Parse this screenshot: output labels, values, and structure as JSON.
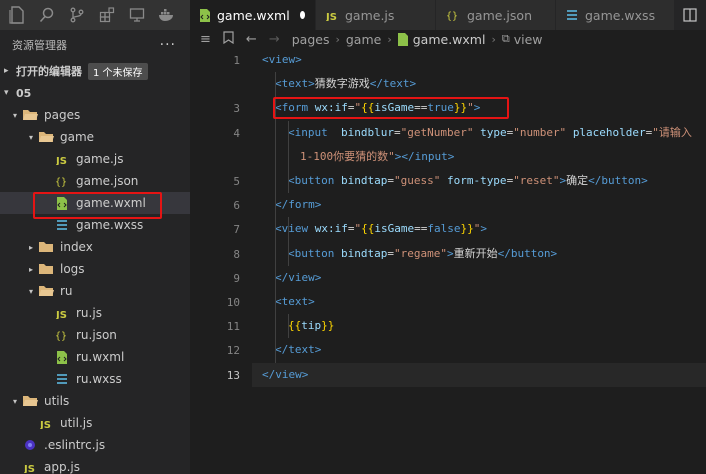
{
  "activity_icons": [
    "files-icon",
    "search-icon",
    "source-control-icon",
    "extensions-icon",
    "debug-icon",
    "docker-icon"
  ],
  "sidebar": {
    "title": "资源管理器",
    "more": "···",
    "open_editors": {
      "label": "打开的编辑器",
      "badge": "1 个未保存"
    },
    "root": "05",
    "tree": [
      {
        "label": "pages",
        "kind": "folder-open",
        "depth": 1
      },
      {
        "label": "game",
        "kind": "folder-open",
        "depth": 2
      },
      {
        "label": "game.js",
        "kind": "js",
        "depth": 3
      },
      {
        "label": "game.json",
        "kind": "json",
        "depth": 3
      },
      {
        "label": "game.wxml",
        "kind": "wxml",
        "depth": 3
      },
      {
        "label": "game.wxss",
        "kind": "wxss",
        "depth": 3
      },
      {
        "label": "index",
        "kind": "folder",
        "depth": 2
      },
      {
        "label": "logs",
        "kind": "folder",
        "depth": 2
      },
      {
        "label": "ru",
        "kind": "folder-open",
        "depth": 2
      },
      {
        "label": "ru.js",
        "kind": "js",
        "depth": 3
      },
      {
        "label": "ru.json",
        "kind": "json",
        "depth": 3
      },
      {
        "label": "ru.wxml",
        "kind": "wxml",
        "depth": 3
      },
      {
        "label": "ru.wxss",
        "kind": "wxss",
        "depth": 3
      },
      {
        "label": "utils",
        "kind": "folder-open",
        "depth": 1
      },
      {
        "label": "util.js",
        "kind": "js",
        "depth": 2
      },
      {
        "label": ".eslintrc.js",
        "kind": "eslint",
        "depth": 1
      },
      {
        "label": "app.js",
        "kind": "js",
        "depth": 1
      }
    ]
  },
  "tabs": [
    {
      "label": "game.wxml",
      "kind": "wxml",
      "active": true,
      "modified": true
    },
    {
      "label": "game.js",
      "kind": "js"
    },
    {
      "label": "game.json",
      "kind": "json"
    },
    {
      "label": "game.wxss",
      "kind": "wxss"
    }
  ],
  "breadcrumb": [
    "pages",
    "game",
    "game.wxml",
    "view"
  ],
  "editor": {
    "current_line": 13,
    "lines": [
      {
        "n": "1",
        "tokens": [
          [
            "t",
            "<view>"
          ]
        ]
      },
      {
        "n": "",
        "tokens": [
          [
            "t",
            "<text>"
          ],
          [
            "w",
            "猜数字游戏"
          ],
          [
            "t",
            "</text>"
          ]
        ]
      },
      {
        "n": "3",
        "tokens": [
          [
            "t",
            "<form "
          ],
          [
            "a",
            "wx:if"
          ],
          [
            "w",
            "="
          ],
          [
            "s",
            "\""
          ],
          [
            "e",
            "{{"
          ],
          [
            "a",
            "isGame"
          ],
          [
            "w",
            "=="
          ],
          [
            "t",
            "true"
          ],
          [
            "e",
            "}}"
          ],
          [
            "s",
            "\""
          ],
          [
            "t",
            ">"
          ]
        ]
      },
      {
        "n": "4",
        "tokens": [
          [
            "t",
            "<input  "
          ],
          [
            "a",
            "bindblur"
          ],
          [
            "w",
            "="
          ],
          [
            "s",
            "\"getNumber\""
          ],
          [
            "w",
            " "
          ],
          [
            "a",
            "type"
          ],
          [
            "w",
            "="
          ],
          [
            "s",
            "\"number\""
          ],
          [
            "w",
            " "
          ],
          [
            "a",
            "placeholder"
          ],
          [
            "w",
            "="
          ],
          [
            "s",
            "\"请输入"
          ]
        ]
      },
      {
        "n": "",
        "tokens": [
          [
            "s",
            "1-100你要猜的数\""
          ],
          [
            "t",
            "></input>"
          ]
        ]
      },
      {
        "n": "5",
        "tokens": [
          [
            "t",
            "<button "
          ],
          [
            "a",
            "bindtap"
          ],
          [
            "w",
            "="
          ],
          [
            "s",
            "\"guess\""
          ],
          [
            "w",
            " "
          ],
          [
            "a",
            "form-type"
          ],
          [
            "w",
            "="
          ],
          [
            "s",
            "\"reset\""
          ],
          [
            "t",
            ">"
          ],
          [
            "w",
            "确定"
          ],
          [
            "t",
            "</button>"
          ]
        ]
      },
      {
        "n": "6",
        "tokens": [
          [
            "t",
            "</form>"
          ]
        ]
      },
      {
        "n": "7",
        "tokens": [
          [
            "t",
            "<view "
          ],
          [
            "a",
            "wx:if"
          ],
          [
            "w",
            "="
          ],
          [
            "s",
            "\""
          ],
          [
            "e",
            "{{"
          ],
          [
            "a",
            "isGame"
          ],
          [
            "w",
            "=="
          ],
          [
            "t",
            "false"
          ],
          [
            "e",
            "}}"
          ],
          [
            "s",
            "\""
          ],
          [
            "t",
            ">"
          ]
        ]
      },
      {
        "n": "8",
        "tokens": [
          [
            "t",
            "<button "
          ],
          [
            "a",
            "bindtap"
          ],
          [
            "w",
            "="
          ],
          [
            "s",
            "\"regame\""
          ],
          [
            "t",
            ">"
          ],
          [
            "w",
            "重新开始"
          ],
          [
            "t",
            "</button>"
          ]
        ]
      },
      {
        "n": "9",
        "tokens": [
          [
            "t",
            "</view>"
          ]
        ]
      },
      {
        "n": "10",
        "tokens": [
          [
            "t",
            "<text>"
          ]
        ]
      },
      {
        "n": "11",
        "tokens": [
          [
            "e",
            "{{"
          ],
          [
            "a",
            "tip"
          ],
          [
            "e",
            "}}"
          ]
        ]
      },
      {
        "n": "12",
        "tokens": [
          [
            "t",
            "</text>"
          ]
        ]
      },
      {
        "n": "13",
        "tokens": [
          [
            "t",
            "</view>"
          ]
        ]
      }
    ]
  },
  "colors": {
    "accent_highlight": "#e51414",
    "js": "#cbcb41",
    "json": "#cbcb41",
    "wxml": "#8dc149",
    "wxss": "#519aba",
    "folder": "#dcb67a"
  }
}
